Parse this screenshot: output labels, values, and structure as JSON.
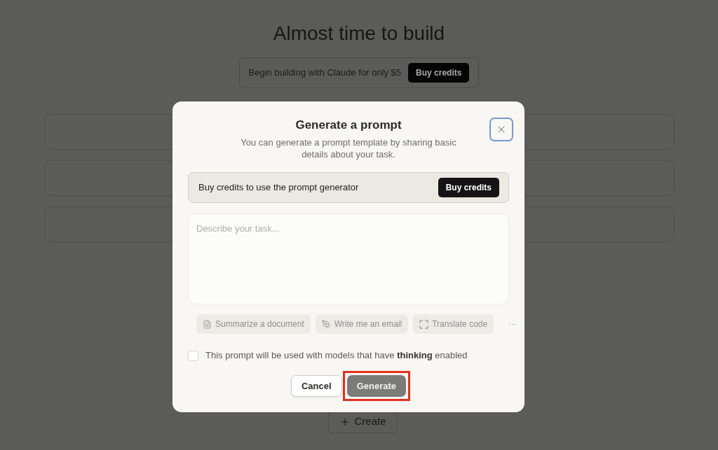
{
  "page": {
    "title": "Almost time to build",
    "banner": {
      "text": "Begin building with Claude for only $5",
      "button": "Buy credits"
    },
    "create_button": {
      "label": "Create"
    }
  },
  "dialog": {
    "title": "Generate a prompt",
    "close_button": {
      "focused": true
    },
    "description": "You can generate a prompt template by sharing basic details about your task.",
    "notice": {
      "text": "Buy credits to use the prompt generator",
      "button": "Buy credits"
    },
    "task_field": {
      "placeholder": "Describe your task..."
    },
    "suggestions": [
      {
        "label": "Summarize a document",
        "disabled": true
      },
      {
        "label": "Write me an email",
        "disabled": true
      },
      {
        "label": "Translate code",
        "disabled": true
      }
    ],
    "more_button": "···",
    "thinking_option": {
      "text": "This prompt will be used with models that have **thinking** enabled",
      "checked": false
    },
    "buttons": [
      {
        "label": "Cancel",
        "kind": "secondary",
        "disabled": false,
        "highlighted": false
      },
      {
        "label": "Generate",
        "kind": "primary",
        "disabled": true,
        "highlighted": true
      }
    ]
  }
}
